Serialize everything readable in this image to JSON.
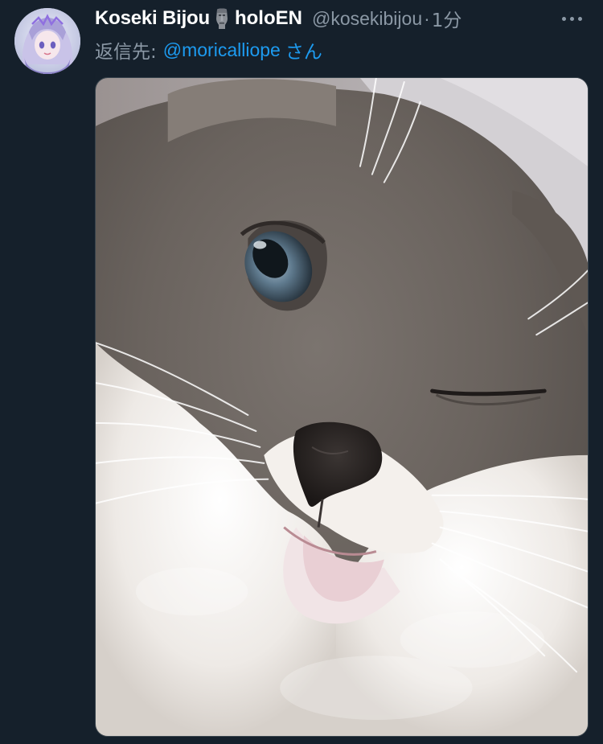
{
  "tweet": {
    "author": {
      "display_name": "Koseki Bijou",
      "name_emoji": "moai-icon",
      "name_suffix": "holoEN",
      "handle": "@kosekibijou",
      "separator": "·",
      "timestamp": "1分"
    },
    "reply": {
      "prefix": "返信先:",
      "mention": "@moricalliope",
      "suffix": "さん"
    },
    "more_icon": "more-horizontal-icon",
    "media": {
      "type": "photo"
    }
  },
  "colors": {
    "background": "#15202b",
    "text_primary": "#ffffff",
    "text_secondary": "#8b98a5",
    "link": "#1d9bf0",
    "border": "#38444d"
  }
}
